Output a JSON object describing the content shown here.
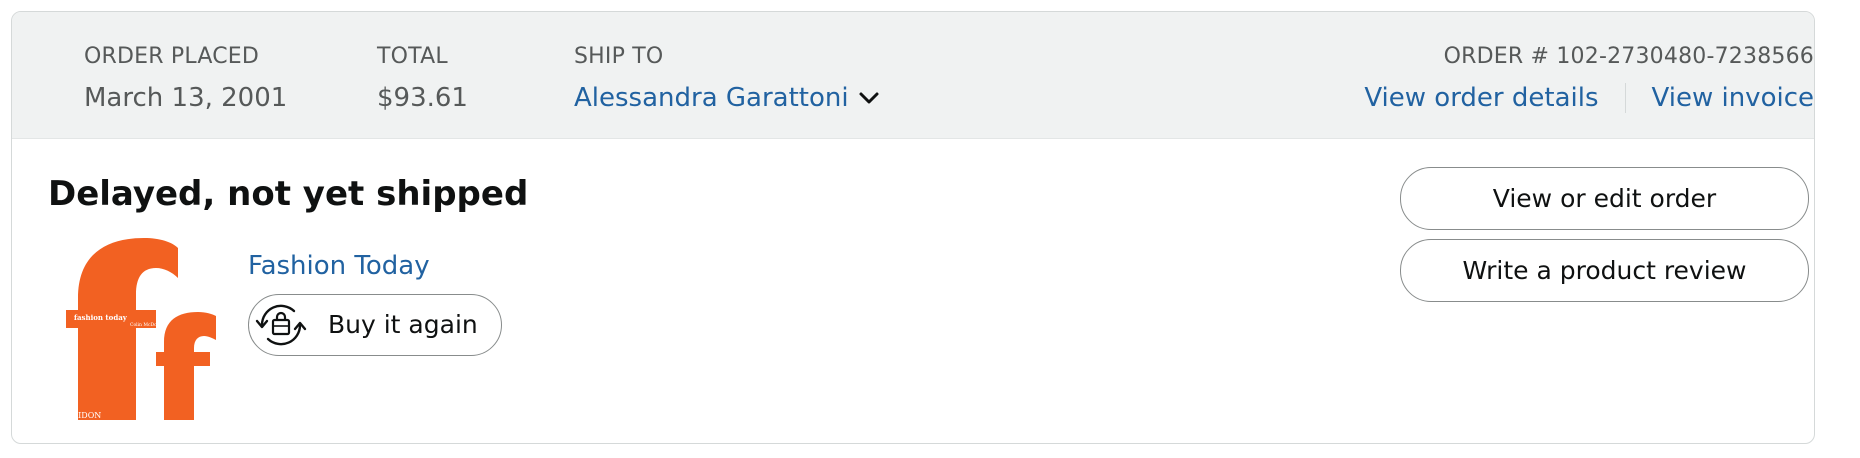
{
  "header": {
    "order_placed_label": "ORDER PLACED",
    "order_placed_value": "March 13, 2001",
    "total_label": "TOTAL",
    "total_value": "$93.61",
    "ship_to_label": "SHIP TO",
    "ship_to_value": "Alessandra Garattoni",
    "ship_to_icon": "chevron-down-icon",
    "order_number": "ORDER # 102-2730480-7238566",
    "view_order_details": "View order details",
    "view_invoice": "View invoice"
  },
  "body": {
    "status": "Delayed, not yet shipped",
    "product": {
      "title": "Fashion Today",
      "thumbnail": {
        "cover_title": "fashion today",
        "cover_author": "Colin McDowell",
        "publisher": "PHAIDON",
        "cover_color": "#f26122"
      }
    },
    "buy_again": {
      "label": "Buy it again",
      "icon": "buy-again-icon"
    },
    "actions": {
      "view_edit_order": "View or edit order",
      "write_review": "Write a product review"
    }
  },
  "colors": {
    "header_bg": "#f0f2f2",
    "link": "#2162a1",
    "text_muted": "#565959",
    "text": "#0f1111",
    "border": "#888c8c"
  }
}
